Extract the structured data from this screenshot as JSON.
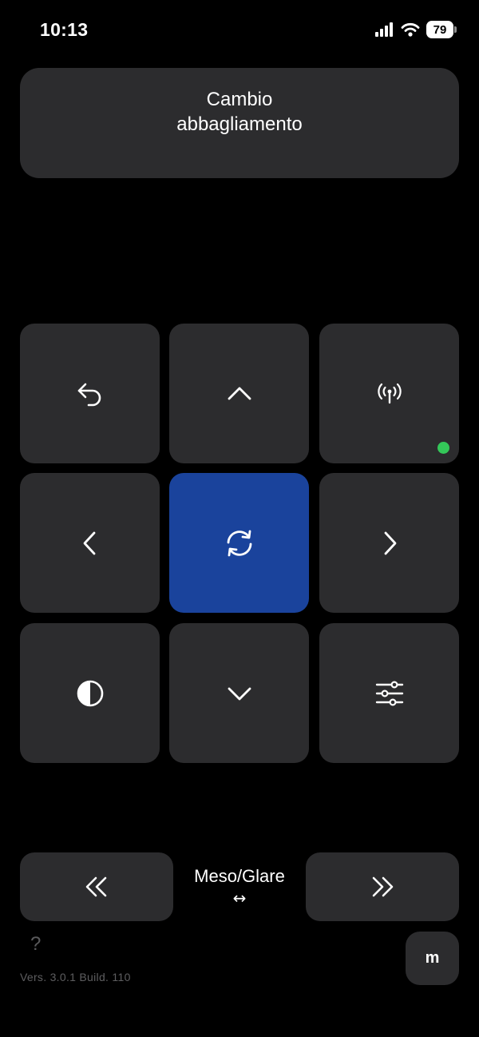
{
  "status_bar": {
    "time": "10:13",
    "battery": "79",
    "icons": [
      "signal-icon",
      "wifi-icon",
      "battery-icon"
    ]
  },
  "title": {
    "line1": "Cambio",
    "line2": "abbagliamento"
  },
  "grid": {
    "buttons": [
      {
        "name": "back-button",
        "icon": "undo-arrow-icon"
      },
      {
        "name": "up-button",
        "icon": "chevron-up-icon"
      },
      {
        "name": "connection-button",
        "icon": "antenna-icon",
        "status_color": "#34c759"
      },
      {
        "name": "left-button",
        "icon": "chevron-left-icon"
      },
      {
        "name": "switch-button",
        "icon": "refresh-icon",
        "active": true,
        "color": "#1a439c"
      },
      {
        "name": "right-button",
        "icon": "chevron-right-icon"
      },
      {
        "name": "contrast-button",
        "icon": "contrast-icon"
      },
      {
        "name": "down-button",
        "icon": "chevron-down-icon"
      },
      {
        "name": "settings-button",
        "icon": "sliders-icon"
      }
    ]
  },
  "bottom": {
    "mode_label": "Meso/Glare",
    "mode_arrow": "↔",
    "prev_icon": "double-chevron-left-icon",
    "next_icon": "double-chevron-right-icon",
    "help": "?",
    "version": "Vers. 3.0.1  Build. 110",
    "m_label": "m"
  },
  "colors": {
    "background": "#000000",
    "tile": "#2c2c2e",
    "accent": "#1a439c",
    "status_green": "#34c759"
  }
}
